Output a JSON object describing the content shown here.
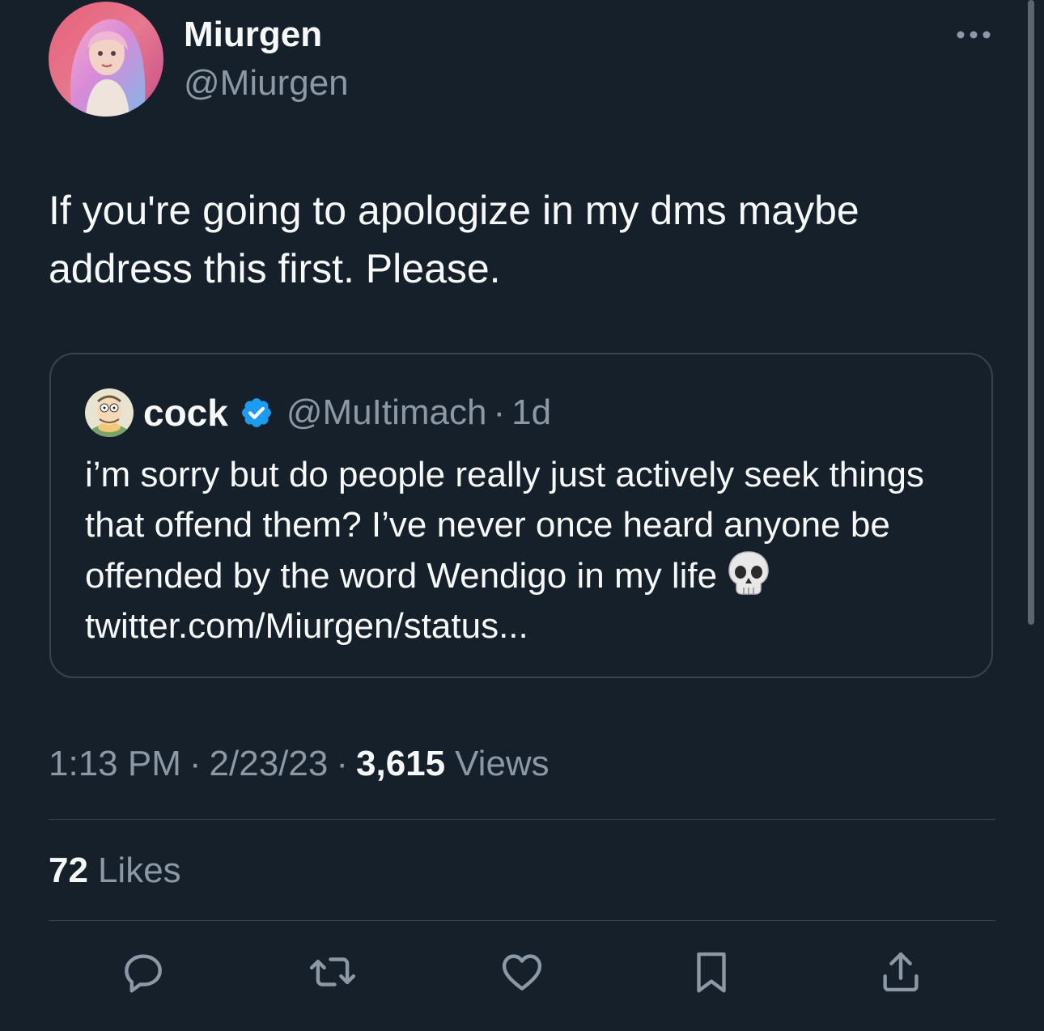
{
  "author": {
    "name": "Miurgen",
    "handle": "@Miurgen"
  },
  "tweet": {
    "text": "If you're going to apologize in my dms maybe address this first. Please."
  },
  "quoted_tweet": {
    "name": "cock",
    "handle": "@MuItimach",
    "separator": "·",
    "time": "1d",
    "text_before_emoji": "i’m sorry but do people really just actively seek things that offend them? I’ve never once heard anyone be offended by the word Wendigo in my life",
    "link": "twitter.com/Miurgen/status..."
  },
  "meta": {
    "time": "1:13 PM",
    "separator": "·",
    "date": "2/23/23",
    "views_count": "3,615",
    "views_label": "Views"
  },
  "engagement": {
    "likes_count": "72",
    "likes_label": "Likes"
  },
  "icons": {
    "more": "more-horizontal-icon",
    "verified": "verified-badge-icon",
    "emoji": "skull-emoji-icon",
    "reply": "reply-icon",
    "retweet": "retweet-icon",
    "like": "heart-icon",
    "bookmark": "bookmark-icon",
    "share": "share-icon"
  },
  "colors": {
    "background": "#15202b",
    "text": "#f7f9f9",
    "secondary_text": "#8b98a5",
    "border": "#38444d",
    "verified": "#1d9bf0"
  }
}
